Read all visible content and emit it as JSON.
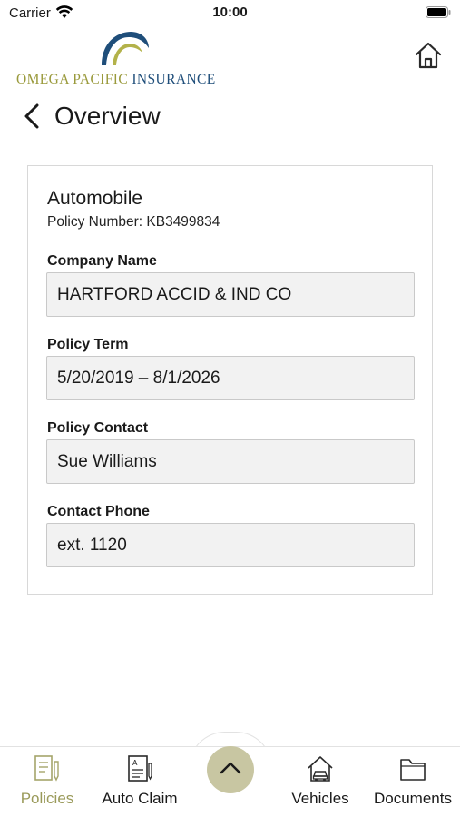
{
  "status_bar": {
    "carrier": "Carrier",
    "time": "10:00"
  },
  "header": {
    "logo_word_1": "OMEGA PACIFIC",
    "logo_word_2": "INSURANCE",
    "logo_colors": {
      "gold": "#9a9a3c",
      "navy": "#1f4e7a"
    },
    "home_icon": "home-icon"
  },
  "nav": {
    "title": "Overview",
    "back_icon": "chevron-left-icon"
  },
  "policy": {
    "type": "Automobile",
    "number_label": "Policy Number: KB3499834",
    "fields": [
      {
        "label": "Company Name",
        "value": "HARTFORD ACCID & IND CO"
      },
      {
        "label": "Policy Term",
        "value": "5/20/2019 – 8/1/2026"
      },
      {
        "label": "Policy Contact",
        "value": "Sue Williams"
      },
      {
        "label": "Contact Phone",
        "value": "ext. 1120"
      }
    ]
  },
  "tab_bar": {
    "accent_color": "#9a9a5a",
    "center_button_color": "#c8c6a2",
    "tabs": [
      {
        "label": "Policies",
        "icon": "policies-icon",
        "active": true
      },
      {
        "label": "Auto Claim",
        "icon": "auto-claim-icon",
        "active": false
      },
      {
        "label": "Vehicles",
        "icon": "vehicles-icon",
        "active": false
      },
      {
        "label": "Documents",
        "icon": "documents-icon",
        "active": false
      }
    ]
  }
}
